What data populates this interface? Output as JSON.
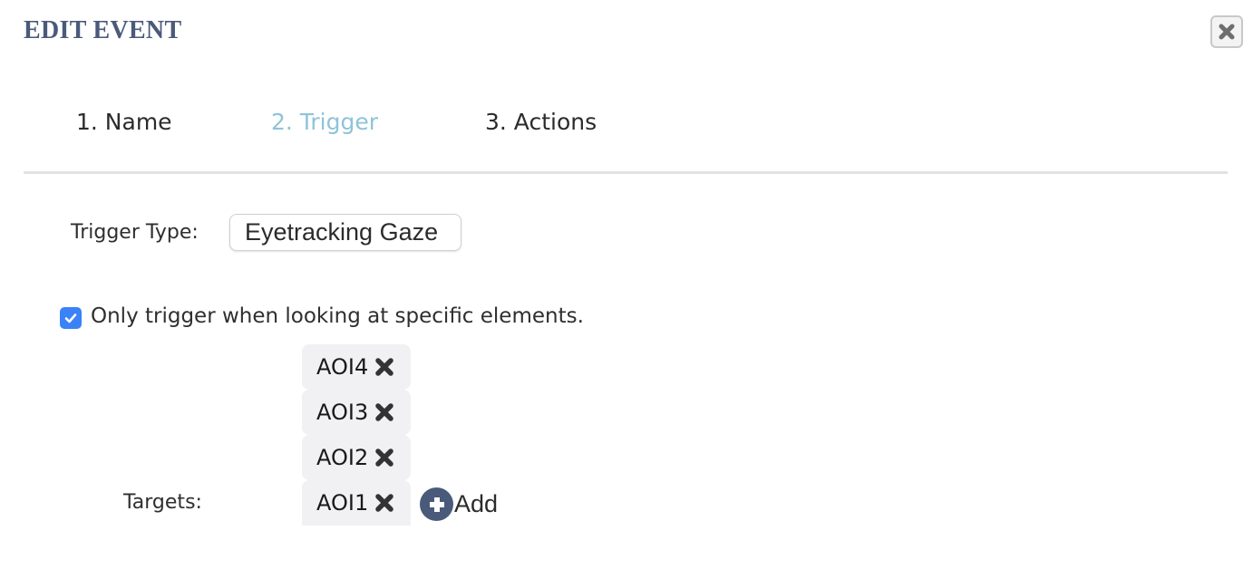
{
  "dialog": {
    "title": "EDIT EVENT",
    "close_icon": "close-icon"
  },
  "tabs": [
    {
      "label": "1. Name",
      "active": false
    },
    {
      "label": "2. Trigger",
      "active": true
    },
    {
      "label": "3. Actions",
      "active": false
    }
  ],
  "trigger": {
    "type_label": "Trigger Type:",
    "type_value": "Eyetracking Gaze",
    "specific_checkbox_checked": true,
    "specific_checkbox_label": "Only trigger when looking at specific elements.",
    "targets_label": "Targets:",
    "targets": [
      "AOI4",
      "AOI3",
      "AOI2",
      "AOI1"
    ],
    "add_label": "Add"
  },
  "colors": {
    "title": "#4a5a7a",
    "active_tab": "#8ec4d8",
    "checkbox": "#3b82f6",
    "chip_bg": "#f1f1f3",
    "add_icon": "#4a5a7a"
  }
}
